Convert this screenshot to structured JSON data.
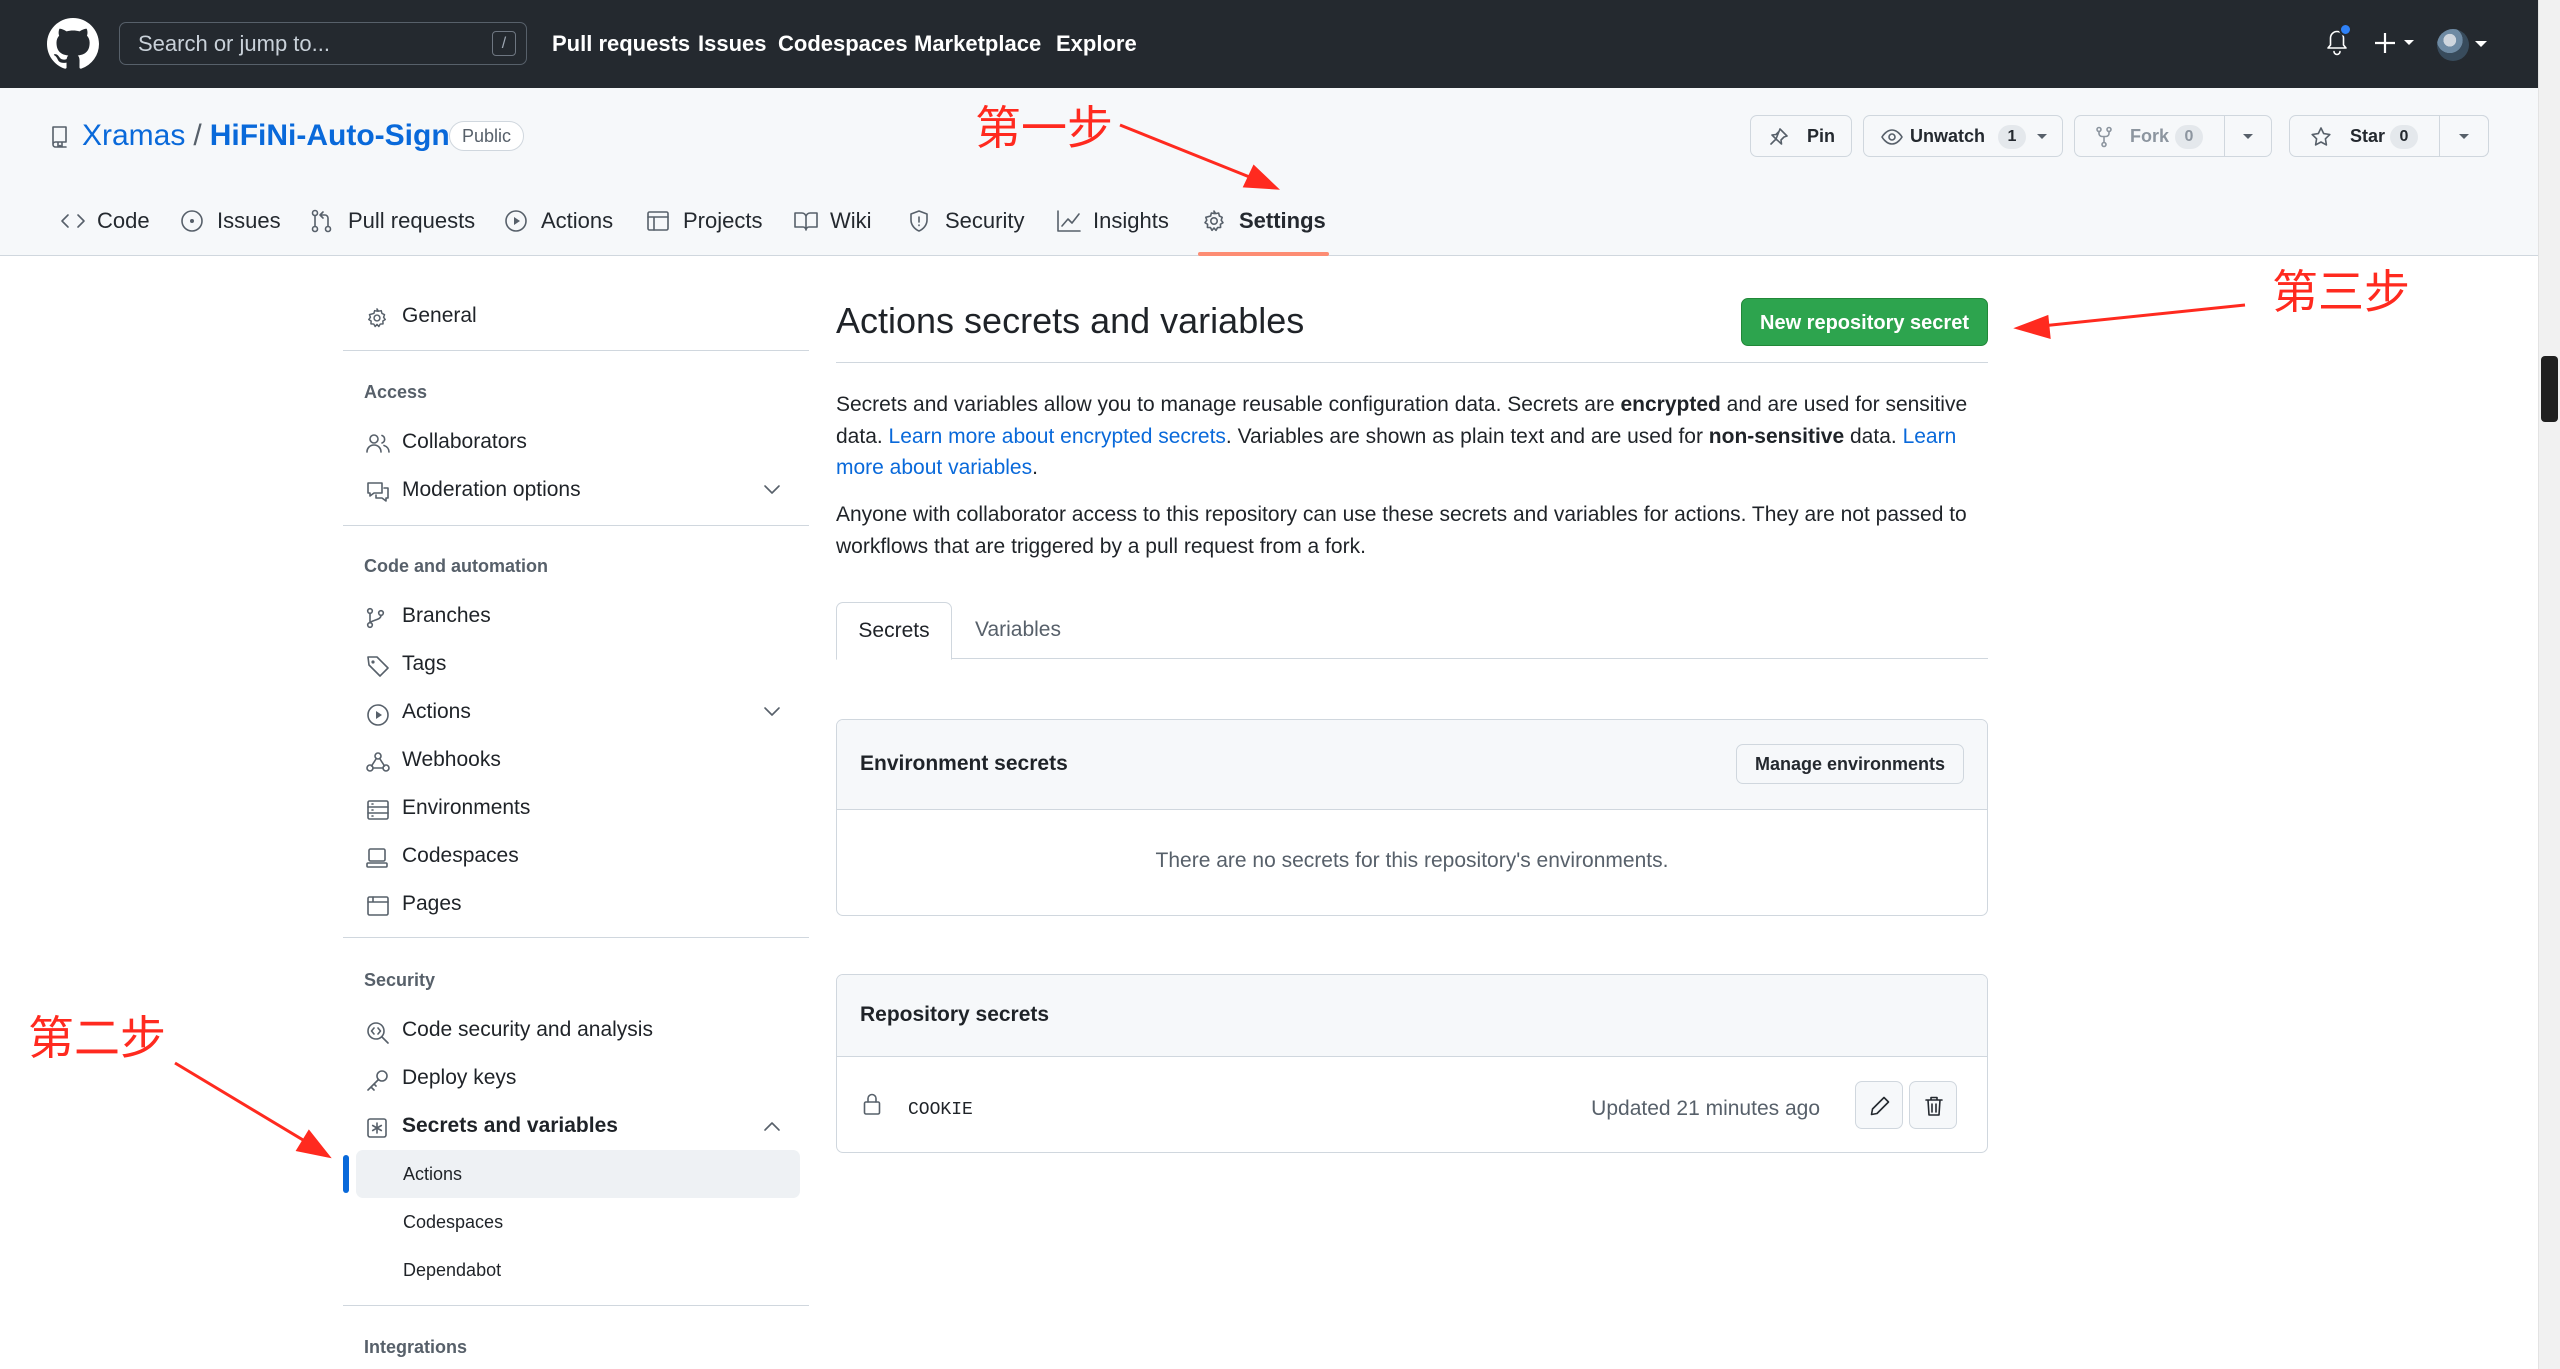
{
  "header": {
    "search_placeholder": "Search or jump to...",
    "search_shortcut": "/",
    "nav": [
      "Pull requests",
      "Issues",
      "Codespaces",
      "Marketplace",
      "Explore"
    ],
    "icons": [
      "github-logo-icon",
      "bell-icon",
      "plus-icon",
      "caret-down-icon",
      "avatar"
    ]
  },
  "repo": {
    "owner": "Xramas",
    "separator": "/",
    "name": "HiFiNi-Auto-Sign",
    "visibility": "Public",
    "pin_label": "Pin",
    "watch_label": "Unwatch",
    "watch_count": "1",
    "fork_label": "Fork",
    "fork_count": "0",
    "star_label": "Star",
    "star_count": "0"
  },
  "tabs": [
    {
      "label": "Code",
      "icon": "code-icon"
    },
    {
      "label": "Issues",
      "icon": "issue-icon"
    },
    {
      "label": "Pull requests",
      "icon": "pull-request-icon"
    },
    {
      "label": "Actions",
      "icon": "play-icon"
    },
    {
      "label": "Projects",
      "icon": "table-icon"
    },
    {
      "label": "Wiki",
      "icon": "book-icon"
    },
    {
      "label": "Security",
      "icon": "shield-icon"
    },
    {
      "label": "Insights",
      "icon": "graph-icon"
    },
    {
      "label": "Settings",
      "icon": "gear-icon",
      "selected": true
    }
  ],
  "sidebar": {
    "general": "General",
    "sections": [
      {
        "heading": "Access",
        "items": [
          "Collaborators",
          "Moderation options"
        ]
      },
      {
        "heading": "Code and automation",
        "items": [
          "Branches",
          "Tags",
          "Actions",
          "Webhooks",
          "Environments",
          "Codespaces",
          "Pages"
        ]
      },
      {
        "heading": "Security",
        "items": [
          "Code security and analysis",
          "Deploy keys",
          "Secrets and variables"
        ]
      },
      {
        "heading": "Integrations",
        "items": []
      }
    ],
    "sub_items": [
      "Actions",
      "Codespaces",
      "Dependabot"
    ],
    "selected_sub_item": "Actions"
  },
  "main": {
    "title": "Actions secrets and variables",
    "new_secret_button": "New repository secret",
    "p1_a": "Secrets and variables allow you to manage reusable configuration data. Secrets are ",
    "p1_b": "encrypted",
    "p1_c": " and are used for sensitive data. ",
    "p1_link1": "Learn more about encrypted secrets",
    "p1_d": ". Variables are shown as plain text and are used for ",
    "p1_e": "non-sensitive",
    "p1_f": " data. ",
    "p1_link2": "Learn more about variables",
    "p1_g": ".",
    "p2": "Anyone with collaborator access to this repository can use these secrets and variables for actions. They are not passed to workflows that are triggered by a pull request from a fork.",
    "tab_secrets": "Secrets",
    "tab_variables": "Variables",
    "env_title": "Environment secrets",
    "manage_env": "Manage environments",
    "env_empty": "There are no secrets for this repository's environments.",
    "repo_title": "Repository secrets",
    "secret": {
      "name": "COOKIE",
      "updated": "Updated 21 minutes ago"
    }
  },
  "annotations": {
    "step1": "第一步",
    "step2": "第二步",
    "step3": "第三步",
    "color": "#ff2a1f"
  },
  "colors": {
    "header_bg": "#24292f",
    "link": "#0969da",
    "primary_button": "#2da44e",
    "selected_tab_underline": "#fd8c73",
    "selected_nav_indicator": "#0969da"
  }
}
